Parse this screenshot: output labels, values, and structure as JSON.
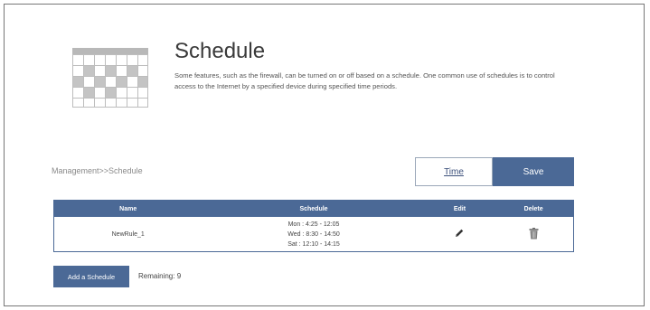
{
  "header": {
    "title": "Schedule",
    "description": "Some features, such as the firewall, can be turned on or off based on a schedule. One common use of schedules is to control access to the Internet by a specified device during specified time periods."
  },
  "breadcrumb": "Management>>Schedule",
  "actions": {
    "time_label": "Time",
    "save_label": "Save"
  },
  "table": {
    "headers": [
      "Name",
      "Schedule",
      "Edit",
      "Delete"
    ],
    "rows": [
      {
        "name": "NewRule_1",
        "schedule": [
          "Mon : 4:25 - 12:05",
          "Wed : 8:30 - 14:50",
          "Sat : 12:10 - 14:15"
        ]
      }
    ]
  },
  "footer": {
    "add_label": "Add a Schedule",
    "remaining": "Remaining: 9"
  },
  "colors": {
    "accent": "#4b6996"
  },
  "icons": {
    "header": "calendar-icon",
    "edit": "pencil-icon",
    "delete": "trash-icon"
  }
}
